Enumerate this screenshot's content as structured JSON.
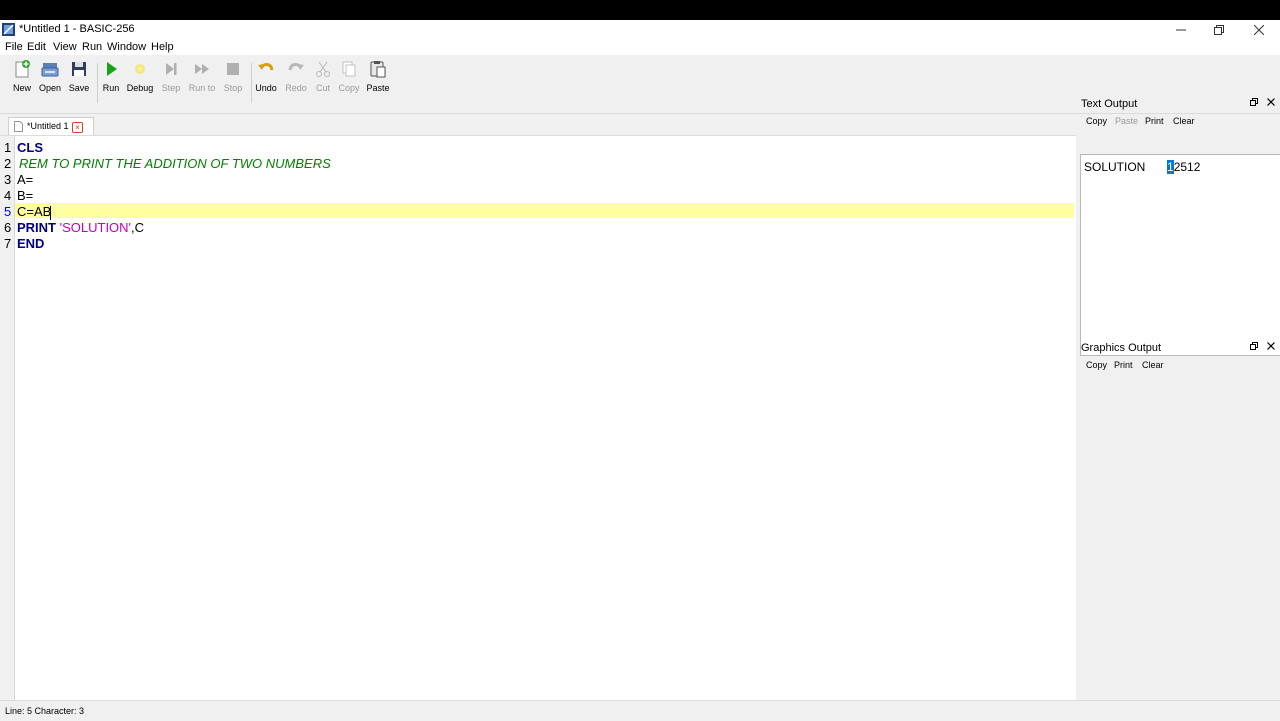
{
  "window": {
    "title": "*Untitled 1 - BASIC-256"
  },
  "menu": [
    "File",
    "Edit",
    "View",
    "Run",
    "Window",
    "Help"
  ],
  "toolbar": {
    "new": "New",
    "open": "Open",
    "save": "Save",
    "run": "Run",
    "debug": "Debug",
    "step": "Step",
    "run_to": "Run to",
    "stop": "Stop",
    "undo": "Undo",
    "redo": "Redo",
    "cut": "Cut",
    "copy": "Copy",
    "paste": "Paste"
  },
  "tab": {
    "label": "*Untitled 1"
  },
  "editor": {
    "line_numbers": [
      "1",
      "2",
      "3",
      "4",
      "5",
      "6",
      "7"
    ],
    "current_line": "5",
    "lines": {
      "l1": "CLS",
      "l2": "REM TO PRINT THE ADDITION OF TWO NUMBERS",
      "l3": "A=",
      "l4": "B=",
      "l5": "C=AB",
      "l6_kw": "PRINT",
      "l6_str": "'SOLUTION'",
      "l6_rest": ",C",
      "l7": "END"
    }
  },
  "text_output": {
    "title": "Text Output",
    "buttons": {
      "copy": "Copy",
      "paste": "Paste",
      "print": "Print",
      "clear": "Clear"
    },
    "content_label": "SOLUTION",
    "content_selected": "1",
    "content_value": "2512"
  },
  "graphics_output": {
    "title": "Graphics Output",
    "buttons": {
      "copy": "Copy",
      "print": "Print",
      "clear": "Clear"
    }
  },
  "status": {
    "text": "Line: 5 Character: 3"
  },
  "colors": {
    "keyword": "#000080",
    "comment": "#008000",
    "string": "#c000c0",
    "current_line": "#ffffa0",
    "selection": "#0078d7"
  }
}
